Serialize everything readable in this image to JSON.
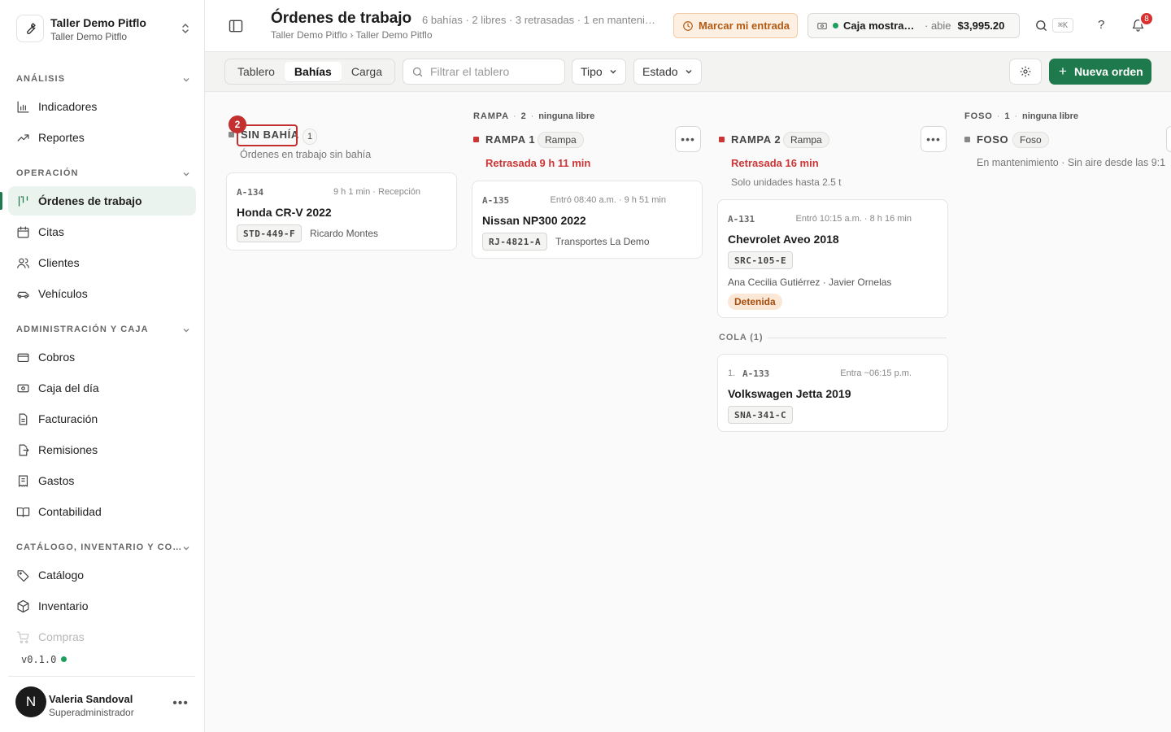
{
  "workspace": {
    "name": "Taller Demo Pitflo",
    "subtitle": "Taller Demo Pitflo"
  },
  "sidebar": {
    "sections": [
      {
        "label": "ANÁLISIS",
        "items": [
          {
            "label": "Indicadores",
            "icon": "bar-chart-icon"
          },
          {
            "label": "Reportes",
            "icon": "trend-icon"
          }
        ]
      },
      {
        "label": "OPERACIÓN",
        "items": [
          {
            "label": "Órdenes de trabajo",
            "icon": "kanban-icon",
            "active": true
          },
          {
            "label": "Citas",
            "icon": "calendar-icon"
          },
          {
            "label": "Clientes",
            "icon": "users-icon"
          },
          {
            "label": "Vehículos",
            "icon": "car-icon"
          }
        ]
      },
      {
        "label": "ADMINISTRACIÓN Y CAJA",
        "items": [
          {
            "label": "Cobros",
            "icon": "card-icon"
          },
          {
            "label": "Caja del día",
            "icon": "cash-icon"
          },
          {
            "label": "Facturación",
            "icon": "file-icon"
          },
          {
            "label": "Remisiones",
            "icon": "file-export-icon"
          },
          {
            "label": "Gastos",
            "icon": "receipt-icon"
          },
          {
            "label": "Contabilidad",
            "icon": "book-icon"
          }
        ]
      },
      {
        "label": "CATÁLOGO, INVENTARIO Y CO…",
        "items": [
          {
            "label": "Catálogo",
            "icon": "tag-icon"
          },
          {
            "label": "Inventario",
            "icon": "box-icon"
          },
          {
            "label": "Compras",
            "icon": "cart-icon"
          }
        ]
      }
    ],
    "version": "v0.1.0",
    "user": {
      "initial": "N",
      "name": "Valeria Sandoval",
      "role": "Superadministrador"
    }
  },
  "header": {
    "title": "Órdenes de trabajo",
    "meta": "6 bahías · 2 libres · 3 retrasadas · 1 en manteni…",
    "breadcrumb": "Taller Demo Pitflo › Taller Demo Pitflo",
    "checkin_label": "Marcar mi entrada",
    "register": {
      "name": "Caja mostrad…",
      "status": "abie",
      "amount": "$3,995.20"
    },
    "shortcut": "⌘K",
    "help": "?",
    "notifications": "8"
  },
  "toolbar": {
    "tabs": [
      "Tablero",
      "Bahías",
      "Carga"
    ],
    "active_tab": "Bahías",
    "filter_placeholder": "Filtrar el tablero",
    "type_label": "Tipo",
    "status_label": "Estado",
    "new_label": "Nueva orden"
  },
  "colors": {
    "accent": "#1e7a4c",
    "late": "#cc3535",
    "warn": "#b35a13"
  },
  "board": {
    "unassigned": {
      "title": "SIN BAHÍA",
      "count": "1",
      "subtitle": "Órdenes en trabajo sin bahía",
      "annotation": "2",
      "card": {
        "id": "A-134",
        "time": "9 h 1 min · Recepción",
        "vehicle": "Honda CR-V 2022",
        "plate": "STD-449-F",
        "client": "Ricardo Montes"
      }
    },
    "groups": [
      {
        "name": "RAMPA",
        "count": "2",
        "availability": "ninguna libre"
      },
      {
        "name": "FOSO",
        "count": "1",
        "availability": "ninguna libre"
      }
    ],
    "bays": [
      {
        "name": "RAMPA 1",
        "type": "Rampa",
        "status": "Retrasada 9 h 11 min",
        "card": {
          "id": "A-135",
          "time": "Entró 08:40 a.m. · 9 h 51 min",
          "vehicle": "Nissan NP300 2022",
          "plate": "RJ-4821-A",
          "client": "Transportes La Demo"
        }
      },
      {
        "name": "RAMPA 2",
        "type": "Rampa",
        "status": "Retrasada 16 min",
        "note": "Solo unidades hasta 2.5 t",
        "card": {
          "id": "A-131",
          "time": "Entró 10:15 a.m. · 8 h 16 min",
          "vehicle": "Chevrolet Aveo 2018",
          "plate": "SRC-105-E",
          "client": "Ana Cecilia Gutiérrez · Javier Ornelas",
          "tag": "Detenida"
        },
        "queue": {
          "label": "COLA (1)",
          "card": {
            "pos": "1.",
            "id": "A-133",
            "time": "Entra ~06:15 p.m.",
            "vehicle": "Volkswagen Jetta 2019",
            "plate": "SNA-341-C"
          }
        }
      },
      {
        "name": "FOSO",
        "type": "Foso",
        "note": "En mantenimiento · Sin aire desde las 9:1"
      }
    ]
  }
}
